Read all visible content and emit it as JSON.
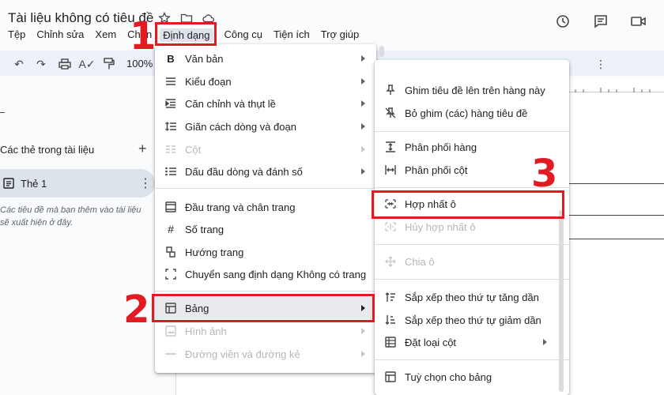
{
  "app": {
    "doc_title": "Tài liệu không có tiêu đề",
    "menubar": [
      "Tệp",
      "Chỉnh sửa",
      "Xem",
      "Chèn",
      "Định dạng",
      "Công cụ",
      "Tiện ích",
      "Trợ giúp"
    ],
    "zoom": "100%"
  },
  "sidebar": {
    "heading": "Các thẻ trong tài liệu",
    "tab_label": "Thẻ 1",
    "hint": "Các tiêu đề mà bạn thêm vào tài liệu sẽ xuất hiện ở đây."
  },
  "format_menu": {
    "items": [
      {
        "label": "Văn bản",
        "icon": "bold-icon"
      },
      {
        "label": "Kiểu đoạn",
        "icon": "paragraph-style-icon"
      },
      {
        "label": "Căn chỉnh và thụt lề",
        "icon": "align-indent-icon"
      },
      {
        "label": "Giãn cách dòng và đoạn",
        "icon": "line-spacing-icon"
      },
      {
        "label": "Cột",
        "icon": "columns-icon"
      },
      {
        "label": "Dấu đầu dòng và đánh số",
        "icon": "bullets-icon"
      },
      {
        "label": "Đầu trang và chân trang",
        "icon": "header-footer-icon"
      },
      {
        "label": "Số trang",
        "icon": "hash-icon"
      },
      {
        "label": "Hướng trang",
        "icon": "orientation-icon"
      },
      {
        "label": "Chuyển sang định dạng Không có trang",
        "icon": "pageless-icon"
      },
      {
        "label": "Bảng",
        "icon": "table-icon"
      },
      {
        "label": "Hình ảnh",
        "icon": "image-icon"
      },
      {
        "label": "Đường viền và đường kẻ",
        "icon": "line-icon"
      }
    ]
  },
  "table_submenu": {
    "items": [
      {
        "label": "Ghim tiêu đề lên trên hàng này",
        "icon": "pin-icon"
      },
      {
        "label": "Bỏ ghim (các) hàng tiêu đề",
        "icon": "unpin-icon"
      },
      {
        "label": "Phân phối hàng",
        "icon": "distribute-rows-icon"
      },
      {
        "label": "Phân phối cột",
        "icon": "distribute-columns-icon"
      },
      {
        "label": "Hợp nhất ô",
        "icon": "merge-cells-icon"
      },
      {
        "label": "Hủy hợp nhất ô",
        "icon": "unmerge-cells-icon"
      },
      {
        "label": "Chia ô",
        "icon": "split-cell-icon"
      },
      {
        "label": "Sắp xếp theo thứ tự tăng dần",
        "icon": "sort-asc-icon"
      },
      {
        "label": "Sắp xếp theo thứ tự giảm dần",
        "icon": "sort-desc-icon"
      },
      {
        "label": "Đặt loại cột",
        "icon": "column-type-icon"
      },
      {
        "label": "Tuỳ chọn cho bảng",
        "icon": "table-options-icon"
      }
    ]
  },
  "annotations": {
    "step1": "1",
    "step2": "2",
    "step3": "3",
    "highlight_color": "#e21b22"
  }
}
